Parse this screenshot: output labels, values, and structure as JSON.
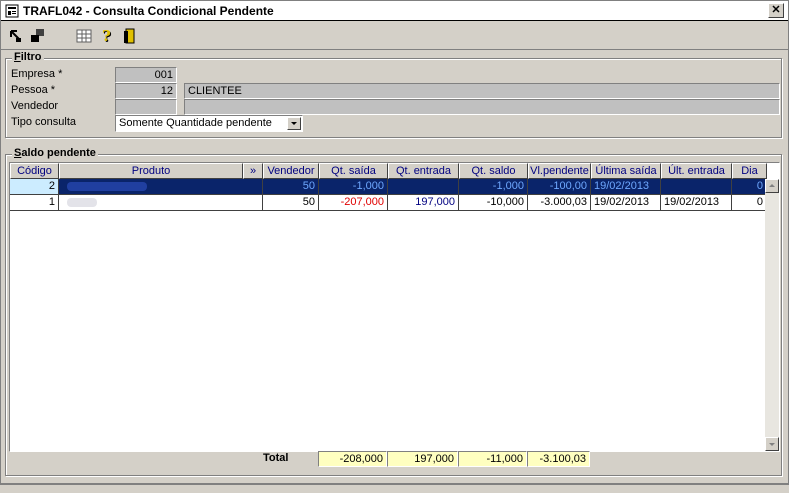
{
  "window": {
    "title": "TRAFL042 - Consulta Condicional Pendente",
    "close_label": "✕"
  },
  "toolbar": {
    "icons": [
      "move-arrow-icon",
      "stack-icon",
      "calculator-icon",
      "help-icon",
      "exit-door-icon"
    ]
  },
  "filtro": {
    "legend_pre": "F",
    "legend_rest": "iltro",
    "empresa_label": "Empresa *",
    "empresa_value": "001",
    "pessoa_label": "Pessoa *",
    "pessoa_value": "12",
    "pessoa_name": "CLIENTEE",
    "vendedor_label": "Vendedor",
    "vendedor_value": "",
    "tipo_label": "Tipo consulta",
    "tipo_value": "Somente Quantidade pendente"
  },
  "saldo": {
    "legend_pre": "S",
    "legend_rest": "aldo pendente",
    "columns": [
      "Código",
      "Produto",
      "»",
      "Vendedor",
      "Qt. saída",
      "Qt. entrada",
      "Qt. saldo",
      "Vl.pendente",
      "Última saída",
      "Últ. entrada",
      "Dia"
    ],
    "rows": [
      {
        "codigo": "2",
        "produto": "",
        "vendedor": "50",
        "qt_saida": "-1,000",
        "qt_entrada": "",
        "qt_saldo": "-1,000",
        "vl_pendente": "-100,00",
        "ultima_saida": "19/02/2013",
        "ult_entrada": "",
        "dia": "0"
      },
      {
        "codigo": "1",
        "produto": "",
        "vendedor": "50",
        "qt_saida": "-207,000",
        "qt_entrada": "197,000",
        "qt_saldo": "-10,000",
        "vl_pendente": "-3.000,03",
        "ultima_saida": "19/02/2013",
        "ult_entrada": "19/02/2013",
        "dia": "0"
      }
    ]
  },
  "totals": {
    "label": "Total",
    "qt_saida": "-208,000",
    "qt_entrada": "197,000",
    "qt_saldo": "-11,000",
    "vl_pendente": "-3.100,03"
  },
  "colors": {
    "selection": "#0a246a",
    "header_text": "#000080",
    "negative": "#e00000",
    "totals_bg": "#ffffc0"
  }
}
